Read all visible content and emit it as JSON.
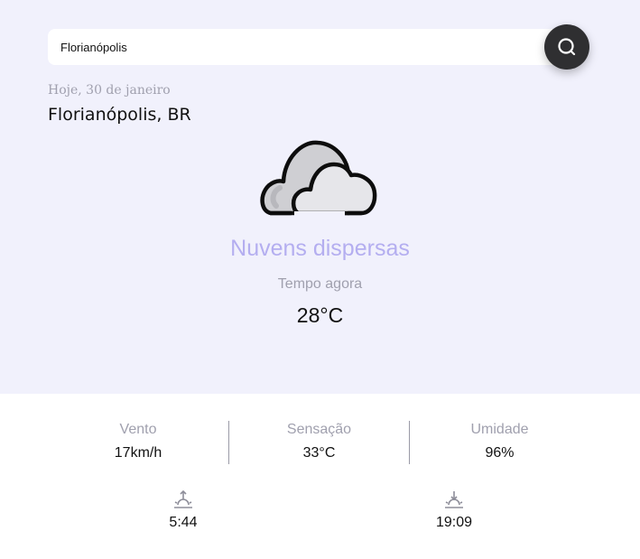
{
  "search": {
    "value": "Florianópolis",
    "icon": "search-icon"
  },
  "location": {
    "date": "Hoje, 30 de janeiro",
    "city": "Florianópolis, BR"
  },
  "current": {
    "icon": "cloud-icon",
    "condition": "Nuvens dispersas",
    "label": "Tempo agora",
    "temperature": "28°C"
  },
  "stats": [
    {
      "label": "Vento",
      "value": "17km/h"
    },
    {
      "label": "Sensação",
      "value": "33°C"
    },
    {
      "label": "Umidade",
      "value": "96%"
    }
  ],
  "sun": {
    "sunrise": {
      "icon": "sunrise-icon",
      "time": "5:44"
    },
    "sunset": {
      "icon": "sunset-icon",
      "time": "19:09"
    }
  },
  "colors": {
    "background_top": "#f1f1fc",
    "accent": "#b4aef0",
    "muted": "#a0a0ae",
    "button": "#2f2f31"
  }
}
